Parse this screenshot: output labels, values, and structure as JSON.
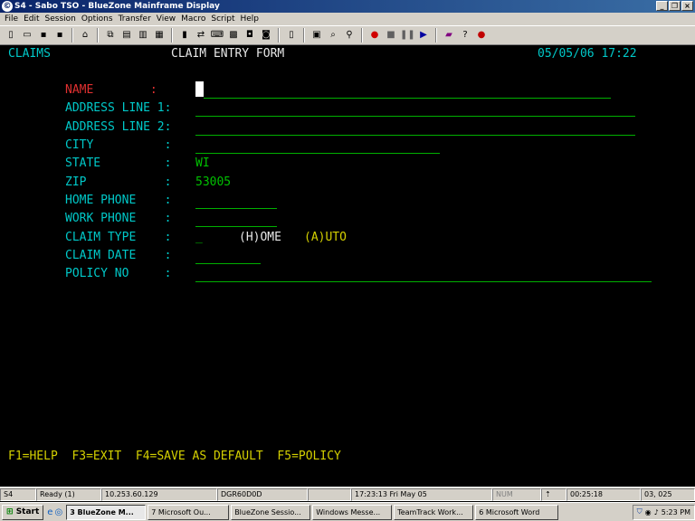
{
  "window": {
    "title": "S4 - Sabo TSO - BlueZone Mainframe Display"
  },
  "menu": [
    "File",
    "Edit",
    "Session",
    "Options",
    "Transfer",
    "View",
    "Macro",
    "Script",
    "Help"
  ],
  "toolbar_icons": [
    "new-icon",
    "open-icon",
    "save-icon",
    "disk-icon",
    "home-icon",
    "copy-icon",
    "paste-icon",
    "print-icon",
    "print-preview-icon",
    "display-icon",
    "transfer-icon",
    "keyboard-icon",
    "hotspot-icon",
    "connect-icon",
    "disconnect-icon",
    "doc-icon",
    "screen-icon",
    "find-icon",
    "zoom-icon",
    "record-icon",
    "stop-icon",
    "pause-icon",
    "play-icon",
    "book-icon",
    "help-icon",
    "apple-icon"
  ],
  "screen": {
    "app": "CLAIMS",
    "title": "CLAIM ENTRY FORM",
    "datetime": "05/05/06 17:22",
    "fields": [
      {
        "label": "NAME        :",
        "value": ""
      },
      {
        "label": "ADDRESS LINE 1:",
        "value": ""
      },
      {
        "label": "ADDRESS LINE 2:",
        "value": ""
      },
      {
        "label": "CITY          :",
        "value": ""
      },
      {
        "label": "STATE         :",
        "value": "WI"
      },
      {
        "label": "ZIP           :",
        "value": "53005"
      },
      {
        "label": "HOME PHONE    :",
        "value": ""
      },
      {
        "label": "WORK PHONE    :",
        "value": ""
      },
      {
        "label": "CLAIM TYPE    :",
        "value": "_"
      },
      {
        "label": "CLAIM DATE    :",
        "value": ""
      },
      {
        "label": "POLICY NO     :",
        "value": ""
      }
    ],
    "claim_type_options": {
      "home": "(H)OME",
      "auto": "(A)UTO"
    },
    "function_keys": "F1=HELP  F3=EXIT  F4=SAVE AS DEFAULT  F5=POLICY"
  },
  "statusbar": [
    "S4",
    "Ready (1)",
    "10.253.60.129",
    "DGR60D0D",
    "",
    "17:23:13  Fri May 05",
    "NUM",
    "",
    "00:25:18",
    "03, 025"
  ],
  "taskbar": {
    "start": "Start",
    "tasks": [
      {
        "label": "3 BlueZone M...",
        "active": true
      },
      {
        "label": "7 Microsoft Ou...",
        "active": false
      },
      {
        "label": "BlueZone Sessio...",
        "active": false
      },
      {
        "label": "Windows Messe...",
        "active": false
      },
      {
        "label": "TeamTrack Work...",
        "active": false
      },
      {
        "label": "6 Microsoft Word",
        "active": false
      }
    ],
    "clock": "5:23 PM"
  }
}
